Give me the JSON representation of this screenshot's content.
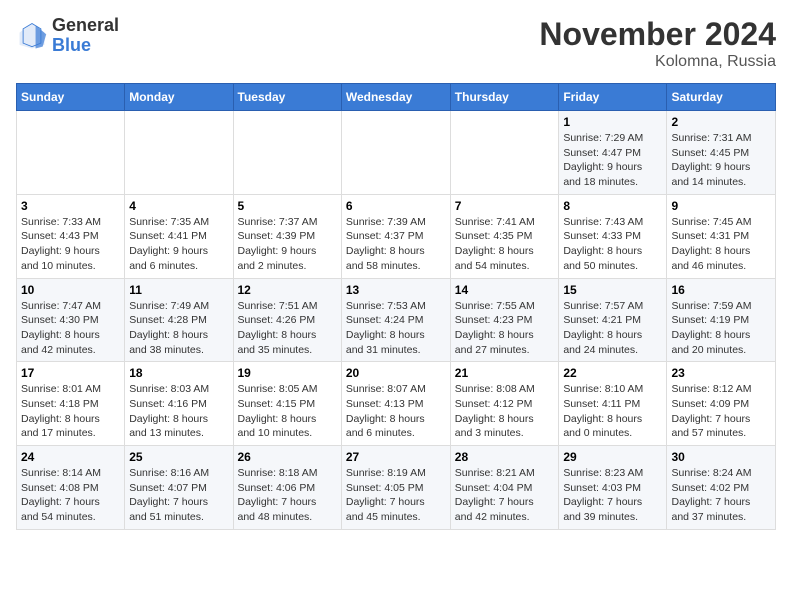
{
  "header": {
    "logo_line1": "General",
    "logo_line2": "Blue",
    "month": "November 2024",
    "location": "Kolomna, Russia"
  },
  "weekdays": [
    "Sunday",
    "Monday",
    "Tuesday",
    "Wednesday",
    "Thursday",
    "Friday",
    "Saturday"
  ],
  "weeks": [
    [
      {
        "day": "",
        "info": ""
      },
      {
        "day": "",
        "info": ""
      },
      {
        "day": "",
        "info": ""
      },
      {
        "day": "",
        "info": ""
      },
      {
        "day": "",
        "info": ""
      },
      {
        "day": "1",
        "info": "Sunrise: 7:29 AM\nSunset: 4:47 PM\nDaylight: 9 hours\nand 18 minutes."
      },
      {
        "day": "2",
        "info": "Sunrise: 7:31 AM\nSunset: 4:45 PM\nDaylight: 9 hours\nand 14 minutes."
      }
    ],
    [
      {
        "day": "3",
        "info": "Sunrise: 7:33 AM\nSunset: 4:43 PM\nDaylight: 9 hours\nand 10 minutes."
      },
      {
        "day": "4",
        "info": "Sunrise: 7:35 AM\nSunset: 4:41 PM\nDaylight: 9 hours\nand 6 minutes."
      },
      {
        "day": "5",
        "info": "Sunrise: 7:37 AM\nSunset: 4:39 PM\nDaylight: 9 hours\nand 2 minutes."
      },
      {
        "day": "6",
        "info": "Sunrise: 7:39 AM\nSunset: 4:37 PM\nDaylight: 8 hours\nand 58 minutes."
      },
      {
        "day": "7",
        "info": "Sunrise: 7:41 AM\nSunset: 4:35 PM\nDaylight: 8 hours\nand 54 minutes."
      },
      {
        "day": "8",
        "info": "Sunrise: 7:43 AM\nSunset: 4:33 PM\nDaylight: 8 hours\nand 50 minutes."
      },
      {
        "day": "9",
        "info": "Sunrise: 7:45 AM\nSunset: 4:31 PM\nDaylight: 8 hours\nand 46 minutes."
      }
    ],
    [
      {
        "day": "10",
        "info": "Sunrise: 7:47 AM\nSunset: 4:30 PM\nDaylight: 8 hours\nand 42 minutes."
      },
      {
        "day": "11",
        "info": "Sunrise: 7:49 AM\nSunset: 4:28 PM\nDaylight: 8 hours\nand 38 minutes."
      },
      {
        "day": "12",
        "info": "Sunrise: 7:51 AM\nSunset: 4:26 PM\nDaylight: 8 hours\nand 35 minutes."
      },
      {
        "day": "13",
        "info": "Sunrise: 7:53 AM\nSunset: 4:24 PM\nDaylight: 8 hours\nand 31 minutes."
      },
      {
        "day": "14",
        "info": "Sunrise: 7:55 AM\nSunset: 4:23 PM\nDaylight: 8 hours\nand 27 minutes."
      },
      {
        "day": "15",
        "info": "Sunrise: 7:57 AM\nSunset: 4:21 PM\nDaylight: 8 hours\nand 24 minutes."
      },
      {
        "day": "16",
        "info": "Sunrise: 7:59 AM\nSunset: 4:19 PM\nDaylight: 8 hours\nand 20 minutes."
      }
    ],
    [
      {
        "day": "17",
        "info": "Sunrise: 8:01 AM\nSunset: 4:18 PM\nDaylight: 8 hours\nand 17 minutes."
      },
      {
        "day": "18",
        "info": "Sunrise: 8:03 AM\nSunset: 4:16 PM\nDaylight: 8 hours\nand 13 minutes."
      },
      {
        "day": "19",
        "info": "Sunrise: 8:05 AM\nSunset: 4:15 PM\nDaylight: 8 hours\nand 10 minutes."
      },
      {
        "day": "20",
        "info": "Sunrise: 8:07 AM\nSunset: 4:13 PM\nDaylight: 8 hours\nand 6 minutes."
      },
      {
        "day": "21",
        "info": "Sunrise: 8:08 AM\nSunset: 4:12 PM\nDaylight: 8 hours\nand 3 minutes."
      },
      {
        "day": "22",
        "info": "Sunrise: 8:10 AM\nSunset: 4:11 PM\nDaylight: 8 hours\nand 0 minutes."
      },
      {
        "day": "23",
        "info": "Sunrise: 8:12 AM\nSunset: 4:09 PM\nDaylight: 7 hours\nand 57 minutes."
      }
    ],
    [
      {
        "day": "24",
        "info": "Sunrise: 8:14 AM\nSunset: 4:08 PM\nDaylight: 7 hours\nand 54 minutes."
      },
      {
        "day": "25",
        "info": "Sunrise: 8:16 AM\nSunset: 4:07 PM\nDaylight: 7 hours\nand 51 minutes."
      },
      {
        "day": "26",
        "info": "Sunrise: 8:18 AM\nSunset: 4:06 PM\nDaylight: 7 hours\nand 48 minutes."
      },
      {
        "day": "27",
        "info": "Sunrise: 8:19 AM\nSunset: 4:05 PM\nDaylight: 7 hours\nand 45 minutes."
      },
      {
        "day": "28",
        "info": "Sunrise: 8:21 AM\nSunset: 4:04 PM\nDaylight: 7 hours\nand 42 minutes."
      },
      {
        "day": "29",
        "info": "Sunrise: 8:23 AM\nSunset: 4:03 PM\nDaylight: 7 hours\nand 39 minutes."
      },
      {
        "day": "30",
        "info": "Sunrise: 8:24 AM\nSunset: 4:02 PM\nDaylight: 7 hours\nand 37 minutes."
      }
    ]
  ]
}
